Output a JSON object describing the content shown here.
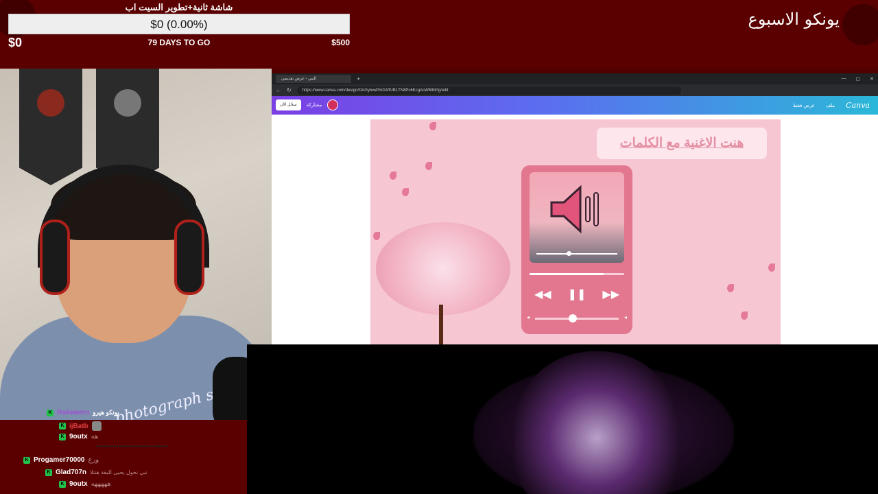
{
  "overlay": {
    "goal_title": "شاشة ثانية+تطوير السيت اب",
    "goal_bar": "$0 (0.00%)",
    "goal_current": "$0",
    "goal_days": "79 DAYS TO GO",
    "goal_max": "$500",
    "goal_progress_percent": 0,
    "week_label": "يونكو الاسبوع"
  },
  "webcam": {
    "shirt_text": "photograph story"
  },
  "browser": {
    "tab_title": "النبي - عرض تقديمي",
    "url": "https://www.canva.com/design/DAGyIuwPmD4/fUB1TN8Ps6KcgAsW69bPg/edit",
    "canva": {
      "logo": "Canva",
      "file_menu": "ملف",
      "view_only": "عرض فقط",
      "share": "مشاركة",
      "login": "سجّل الآن"
    },
    "slide": {
      "title": "هنت الاغنية مع الكلمات",
      "player_progress": 0.78,
      "volume_level": 0.45
    }
  },
  "chat": {
    "messages": [
      {
        "user": "Rokwamn",
        "text": "يونكو هيرو"
      },
      {
        "user": "ijBatb",
        "text": ""
      },
      {
        "user": "9outx",
        "text": "هه"
      },
      {
        "user": "",
        "text": "●●●●●●●●●●●●●●●●●●●●●●●●●●●●●"
      },
      {
        "user": "Progamer70000",
        "text": "ورع"
      },
      {
        "user": "Glad707n",
        "text": "نبي نحول يحيى للبقة هنتلا"
      },
      {
        "user": "9outx",
        "text": "هههههه"
      }
    ]
  }
}
